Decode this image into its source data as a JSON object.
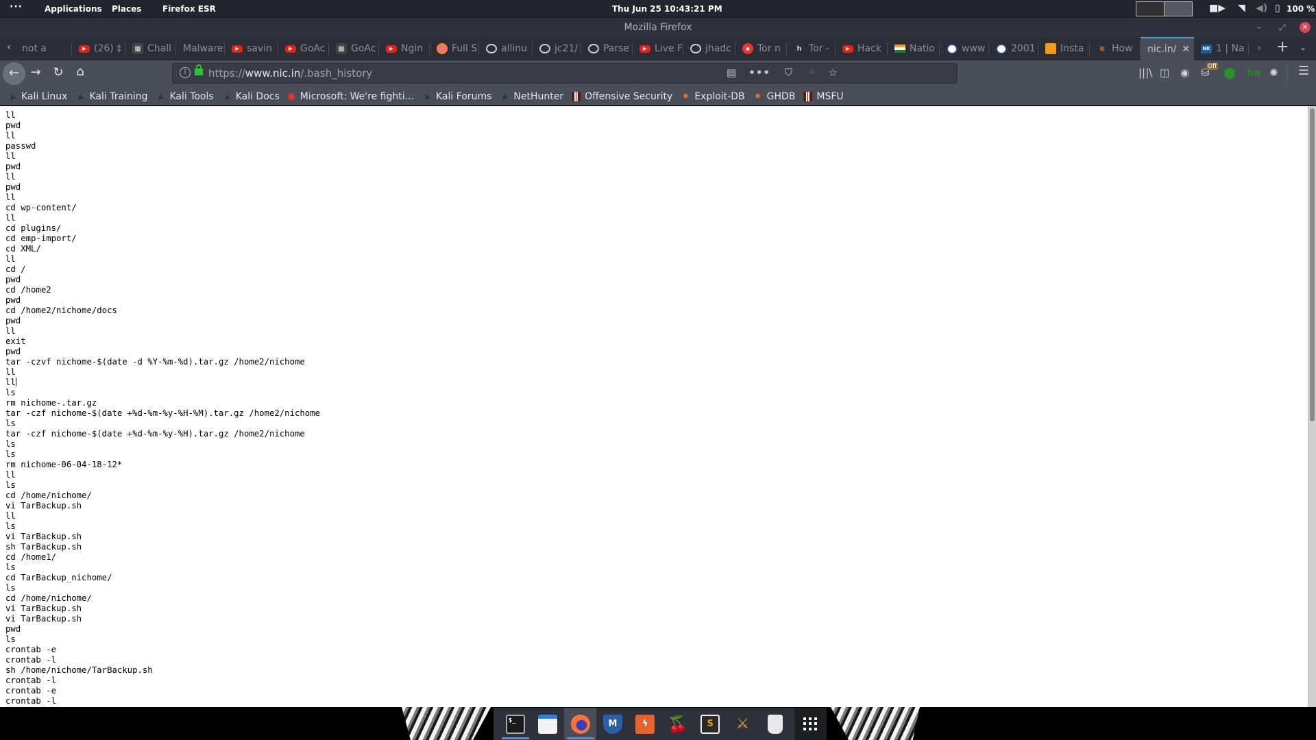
{
  "system_panel": {
    "dots": "···",
    "applications": "Applications",
    "places": "Places",
    "active_app": "Firefox ESR",
    "clock": "Thu Jun 25  10:43:21 PM",
    "battery": "100 %",
    "icons": [
      "workspace-switcher",
      "video-icon",
      "wifi-icon",
      "volume-icon",
      "battery-icon"
    ]
  },
  "window": {
    "title": "Mozilla Firefox",
    "minimize": "–",
    "maximize": "⤢",
    "close": "✕"
  },
  "tabs": {
    "scroll_left": "‹",
    "scroll_right": "›",
    "new_tab": "+",
    "list_all": "⌄",
    "items": [
      {
        "title": "not a",
        "favicon": "none"
      },
      {
        "title": "(26) ‡",
        "favicon": "youtube"
      },
      {
        "title": "Chall",
        "favicon": "dark"
      },
      {
        "title": "Malware",
        "favicon": "none"
      },
      {
        "title": "savin",
        "favicon": "youtube"
      },
      {
        "title": "GoAc",
        "favicon": "youtube"
      },
      {
        "title": "GoAc",
        "favicon": "dark"
      },
      {
        "title": "Ngin",
        "favicon": "youtube"
      },
      {
        "title": "Full S",
        "favicon": "ring"
      },
      {
        "title": "allinu",
        "favicon": "github"
      },
      {
        "title": "jc21/",
        "favicon": "github"
      },
      {
        "title": "Parse",
        "favicon": "github"
      },
      {
        "title": "Live F",
        "favicon": "youtube"
      },
      {
        "title": "jhadc",
        "favicon": "github"
      },
      {
        "title": "Tor n",
        "favicon": "red"
      },
      {
        "title": "Tor -",
        "favicon": "h"
      },
      {
        "title": "Hack",
        "favicon": "youtube"
      },
      {
        "title": "Natio",
        "favicon": "flag"
      },
      {
        "title": "www",
        "favicon": "circle"
      },
      {
        "title": "2001",
        "favicon": "circle"
      },
      {
        "title": "Insta",
        "favicon": "box"
      },
      {
        "title": "How",
        "favicon": "stackoverflow"
      },
      {
        "title": "nic.in/",
        "favicon": "none",
        "active": true,
        "close": "✕"
      },
      {
        "title": "1 | Na",
        "favicon": "nk"
      }
    ]
  },
  "navbar": {
    "back": "←",
    "forward": "→",
    "reload": "↻",
    "home": "⌂",
    "url_scheme": "https://",
    "url_host": "www.nic.in",
    "url_path": "/.bash_history",
    "info_icon": "i",
    "reader": "▤",
    "more": "•••",
    "pocket": "⛉",
    "extension": "⚘",
    "star": "☆",
    "library": "|||\\",
    "sidebar": "◫",
    "account": "◉",
    "off_badge": "Off",
    "off_icon": "⛁",
    "bw": "bw",
    "mask": "✺",
    "menu": "☰"
  },
  "bookmarks": [
    {
      "label": "Kali Linux",
      "icon": "kali"
    },
    {
      "label": "Kali Training",
      "icon": "kali"
    },
    {
      "label": "Kali Tools",
      "icon": "kali"
    },
    {
      "label": "Kali Docs",
      "icon": "kali"
    },
    {
      "label": "Microsoft: We're fighti...",
      "icon": "red"
    },
    {
      "label": "Kali Forums",
      "icon": "kali"
    },
    {
      "label": "NetHunter",
      "icon": "kali"
    },
    {
      "label": "Offensive Security",
      "icon": "offsec"
    },
    {
      "label": "Exploit-DB",
      "icon": "bug"
    },
    {
      "label": "GHDB",
      "icon": "bug"
    },
    {
      "label": "MSFU",
      "icon": "offsec"
    }
  ],
  "page": {
    "lines": [
      "ll",
      "pwd",
      "ll",
      "passwd",
      "ll",
      "pwd",
      "ll",
      "pwd",
      "ll",
      "cd wp-content/",
      "ll",
      "cd plugins/",
      "cd emp-import/",
      "cd XML/",
      "ll",
      "cd /",
      "pwd",
      "cd /home2",
      "pwd",
      "cd /home2/nichome/docs",
      "pwd",
      "ll",
      "exit",
      "pwd",
      "tar -czvf nichome-$(date -d %Y-%m-%d).tar.gz /home2/nichome",
      "ll",
      "ll",
      "ls",
      "rm nichome-.tar.gz",
      "tar -czf nichome-$(date +%d-%m-%y-%H-%M).tar.gz /home2/nichome",
      "ls",
      "tar -czf nichome-$(date +%d-%m-%y-%H).tar.gz /home2/nichome",
      "ls",
      "ls",
      "rm nichome-06-04-18-12*",
      "ll",
      "ls",
      "cd /home/nichome/",
      "vi TarBackup.sh",
      "ll",
      "ls",
      "vi TarBackup.sh",
      "sh TarBackup.sh",
      "cd /home1/",
      "ls",
      "cd TarBackup_nichome/",
      "ls",
      "cd /home/nichome/",
      "vi TarBackup.sh",
      "vi TarBackup.sh",
      "pwd",
      "ls",
      "crontab -e",
      "crontab -l",
      "sh /home/nichome/TarBackup.sh",
      "crontab -l",
      "crontab -e",
      "crontab -l"
    ],
    "caret_line_index": 26,
    "scroll_position_fraction": 0.0
  },
  "dock": {
    "items": [
      {
        "name": "terminal",
        "glyph": "$_",
        "running": true
      },
      {
        "name": "files",
        "glyph": ""
      },
      {
        "name": "firefox",
        "glyph": "",
        "running": true,
        "focused": true
      },
      {
        "name": "metasploit",
        "glyph": "M"
      },
      {
        "name": "burpsuite",
        "glyph": "ϟ"
      },
      {
        "name": "cherrytree",
        "glyph": "🍒"
      },
      {
        "name": "sublime-text",
        "glyph": "S"
      },
      {
        "name": "armitage",
        "glyph": "⚔"
      },
      {
        "name": "trash",
        "glyph": ""
      }
    ],
    "show_apps": "show-applications"
  },
  "colors": {
    "panel_bg": "#22252d",
    "tab_active_accent": "#4c9eea",
    "lock_green": "#2ec22e",
    "page_bg": "#ffffff"
  }
}
